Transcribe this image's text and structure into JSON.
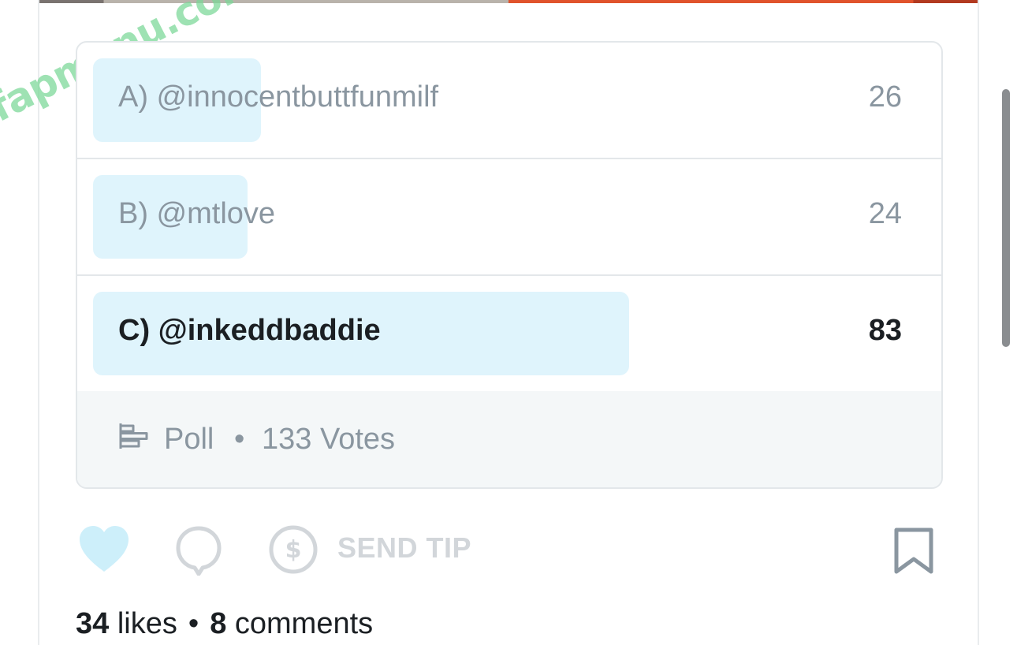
{
  "watermark": "fapmenu.com",
  "poll": {
    "options": [
      {
        "label": "A) @innocentbuttfunmilf",
        "votes": "26",
        "share": 0.195
      },
      {
        "label": "B) @mtlove",
        "votes": "24",
        "share": 0.18
      },
      {
        "label": "C) @inkeddbaddie",
        "votes": "83",
        "share": 0.624
      }
    ],
    "footer": {
      "icon": "poll-bars-icon",
      "type_label": "Poll",
      "separator": "•",
      "votes_label": "133 Votes"
    }
  },
  "actions": {
    "like_icon": "heart-icon",
    "comment_icon": "comment-bubble-icon",
    "tip_icon": "dollar-circle-icon",
    "send_tip_label": "SEND TIP",
    "bookmark_icon": "bookmark-icon"
  },
  "stats": {
    "likes_count": "34",
    "likes_label": "likes",
    "separator": "•",
    "comments_count": "8",
    "comments_label": "comments"
  },
  "colors": {
    "option_fill": "#dff4fc",
    "muted_text": "#8a96a0",
    "strong_text": "#1b1f23",
    "heart": "#cdeffa",
    "disabled_icon": "#d2d6da",
    "bookmark": "#8a96a0"
  }
}
